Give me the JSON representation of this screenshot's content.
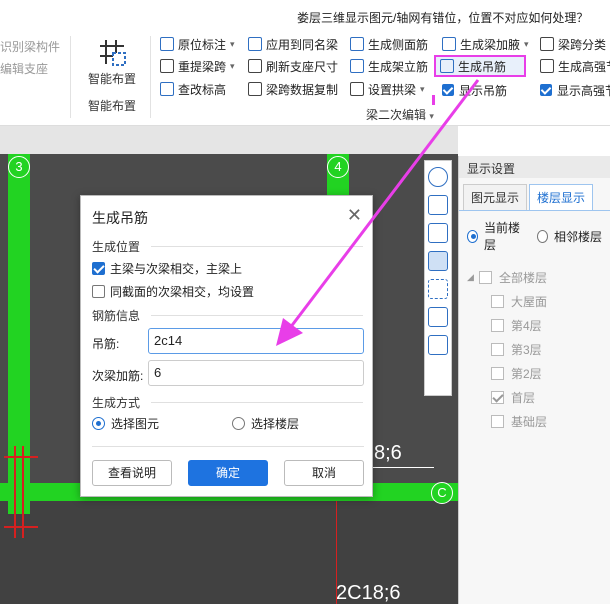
{
  "top_question": "娄层三维显示图元/轴网有错位，位置不对应如何处理？",
  "ribbon": {
    "left_items": [
      "识别梁构件",
      "编辑支座"
    ],
    "smart_layout_label": "智能布置",
    "smart_layout_group": "智能布置",
    "col1": [
      "原位标注",
      "重提梁跨",
      "查改标高"
    ],
    "col2": [
      "应用到同名梁",
      "刷新支座尺寸",
      "梁跨数据复制"
    ],
    "col3": [
      "生成侧面筋",
      "生成架立筋",
      "设置拱梁"
    ],
    "col4": [
      "生成梁加腋",
      "生成吊筋",
      "显示吊筋"
    ],
    "col5": [
      "梁跨分类",
      "生成高强节",
      "显示高强节"
    ],
    "group_label": "梁二次编辑"
  },
  "canvas": {
    "axis_labels": [
      "3",
      "4",
      "C"
    ],
    "text1": "8;6",
    "text2": "2C18;6"
  },
  "panel": {
    "header": "显示设置",
    "tabs": [
      "图元显示",
      "楼层显示"
    ],
    "radio_current": "当前楼层",
    "radio_adjacent": "相邻楼层",
    "tree_root": "全部楼层",
    "floors": [
      {
        "name": "大屋面",
        "checked": false
      },
      {
        "name": "第4层",
        "checked": false
      },
      {
        "name": "第3层",
        "checked": false
      },
      {
        "name": "第2层",
        "checked": false
      },
      {
        "name": "首层",
        "checked": true
      },
      {
        "name": "基础层",
        "checked": false
      }
    ]
  },
  "dialog": {
    "title": "生成吊筋",
    "section_position": "生成位置",
    "opt1": "主梁与次梁相交，主梁上",
    "opt1_checked": true,
    "opt2": "同截面的次梁相交，均设置",
    "opt2_checked": false,
    "section_rebar": "钢筋信息",
    "hanger_label": "吊筋:",
    "hanger_value": "2c14",
    "secondary_label": "次梁加筋:",
    "secondary_value": "6",
    "section_method": "生成方式",
    "method_select_elem": "选择图元",
    "method_select_floor": "选择楼层",
    "btn_help": "查看说明",
    "btn_ok": "确定",
    "btn_cancel": "取消"
  },
  "colors": {
    "accent": "#1e73e0",
    "highlight": "#e83ee8",
    "beam_green": "#22d322"
  }
}
